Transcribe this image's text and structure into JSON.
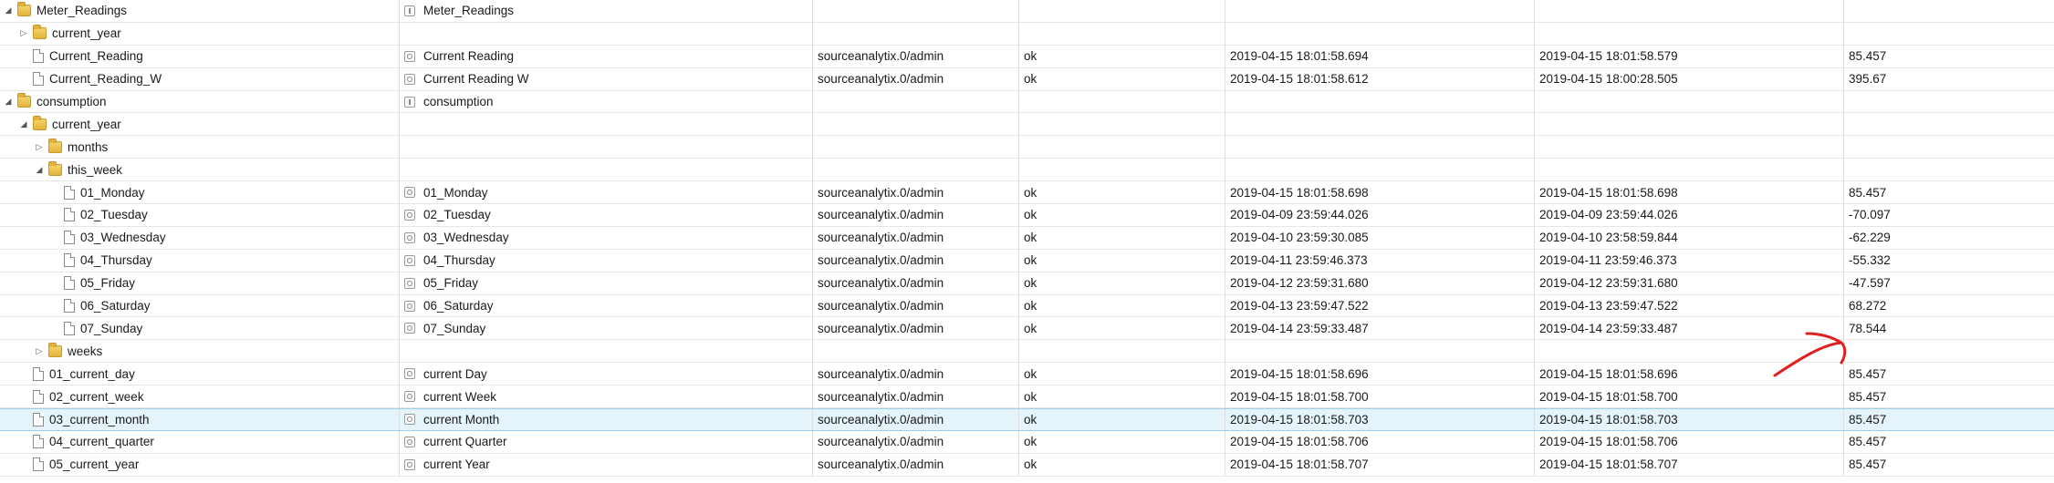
{
  "colors": {
    "annotation": "#e02020",
    "selection": "#e5f3fb",
    "folder": "#e2b33c"
  },
  "rows": [
    {
      "depth": 0,
      "expand": "expanded",
      "icon": "folder-icon",
      "id": "Meter_Readings",
      "name_icon": "channel-icon",
      "name": "Meter_Readings",
      "from": "",
      "ack": "",
      "ts": "",
      "lc": "",
      "value": ""
    },
    {
      "depth": 1,
      "expand": "collapsed",
      "icon": "folder-icon",
      "id": "current_year",
      "name_icon": "",
      "name": "",
      "from": "",
      "ack": "",
      "ts": "",
      "lc": "",
      "value": ""
    },
    {
      "depth": 1,
      "expand": "none",
      "icon": "file-icon",
      "id": "Current_Reading",
      "name_icon": "state-icon",
      "name": "Current Reading",
      "from": "sourceanalytix.0/admin",
      "ack": "ok",
      "ts": "2019-04-15 18:01:58.694",
      "lc": "2019-04-15 18:01:58.579",
      "value": "85.457"
    },
    {
      "depth": 1,
      "expand": "none",
      "icon": "file-icon",
      "id": "Current_Reading_W",
      "name_icon": "state-icon",
      "name": "Current Reading W",
      "from": "sourceanalytix.0/admin",
      "ack": "ok",
      "ts": "2019-04-15 18:01:58.612",
      "lc": "2019-04-15 18:00:28.505",
      "value": "395.67"
    },
    {
      "depth": 0,
      "expand": "expanded",
      "icon": "folder-icon",
      "id": "consumption",
      "name_icon": "channel-icon",
      "name": "consumption",
      "from": "",
      "ack": "",
      "ts": "",
      "lc": "",
      "value": ""
    },
    {
      "depth": 1,
      "expand": "expanded",
      "icon": "folder-icon",
      "id": "current_year",
      "name_icon": "",
      "name": "",
      "from": "",
      "ack": "",
      "ts": "",
      "lc": "",
      "value": ""
    },
    {
      "depth": 2,
      "expand": "collapsed",
      "icon": "folder-icon",
      "id": "months",
      "name_icon": "",
      "name": "",
      "from": "",
      "ack": "",
      "ts": "",
      "lc": "",
      "value": ""
    },
    {
      "depth": 2,
      "expand": "expanded",
      "icon": "folder-icon",
      "id": "this_week",
      "name_icon": "",
      "name": "",
      "from": "",
      "ack": "",
      "ts": "",
      "lc": "",
      "value": ""
    },
    {
      "depth": 3,
      "expand": "none",
      "icon": "file-icon",
      "id": "01_Monday",
      "name_icon": "state-icon",
      "name": "01_Monday",
      "from": "sourceanalytix.0/admin",
      "ack": "ok",
      "ts": "2019-04-15 18:01:58.698",
      "lc": "2019-04-15 18:01:58.698",
      "value": "85.457"
    },
    {
      "depth": 3,
      "expand": "none",
      "icon": "file-icon",
      "id": "02_Tuesday",
      "name_icon": "state-icon",
      "name": "02_Tuesday",
      "from": "sourceanalytix.0/admin",
      "ack": "ok",
      "ts": "2019-04-09 23:59:44.026",
      "lc": "2019-04-09 23:59:44.026",
      "value": "-70.097"
    },
    {
      "depth": 3,
      "expand": "none",
      "icon": "file-icon",
      "id": "03_Wednesday",
      "name_icon": "state-icon",
      "name": "03_Wednesday",
      "from": "sourceanalytix.0/admin",
      "ack": "ok",
      "ts": "2019-04-10 23:59:30.085",
      "lc": "2019-04-10 23:58:59.844",
      "value": "-62.229"
    },
    {
      "depth": 3,
      "expand": "none",
      "icon": "file-icon",
      "id": "04_Thursday",
      "name_icon": "state-icon",
      "name": "04_Thursday",
      "from": "sourceanalytix.0/admin",
      "ack": "ok",
      "ts": "2019-04-11 23:59:46.373",
      "lc": "2019-04-11 23:59:46.373",
      "value": "-55.332"
    },
    {
      "depth": 3,
      "expand": "none",
      "icon": "file-icon",
      "id": "05_Friday",
      "name_icon": "state-icon",
      "name": "05_Friday",
      "from": "sourceanalytix.0/admin",
      "ack": "ok",
      "ts": "2019-04-12 23:59:31.680",
      "lc": "2019-04-12 23:59:31.680",
      "value": "-47.597"
    },
    {
      "depth": 3,
      "expand": "none",
      "icon": "file-icon",
      "id": "06_Saturday",
      "name_icon": "state-icon",
      "name": "06_Saturday",
      "from": "sourceanalytix.0/admin",
      "ack": "ok",
      "ts": "2019-04-13 23:59:47.522",
      "lc": "2019-04-13 23:59:47.522",
      "value": "68.272"
    },
    {
      "depth": 3,
      "expand": "none",
      "icon": "file-icon",
      "id": "07_Sunday",
      "name_icon": "state-icon",
      "name": "07_Sunday",
      "from": "sourceanalytix.0/admin",
      "ack": "ok",
      "ts": "2019-04-14 23:59:33.487",
      "lc": "2019-04-14 23:59:33.487",
      "value": "78.544"
    },
    {
      "depth": 2,
      "expand": "collapsed",
      "icon": "folder-icon",
      "id": "weeks",
      "name_icon": "",
      "name": "",
      "from": "",
      "ack": "",
      "ts": "",
      "lc": "",
      "value": ""
    },
    {
      "depth": 1,
      "expand": "none",
      "icon": "file-icon",
      "id": "01_current_day",
      "name_icon": "state-icon",
      "name": "current Day",
      "from": "sourceanalytix.0/admin",
      "ack": "ok",
      "ts": "2019-04-15 18:01:58.696",
      "lc": "2019-04-15 18:01:58.696",
      "value": "85.457"
    },
    {
      "depth": 1,
      "expand": "none",
      "icon": "file-icon",
      "id": "02_current_week",
      "name_icon": "state-icon",
      "name": "current Week",
      "from": "sourceanalytix.0/admin",
      "ack": "ok",
      "ts": "2019-04-15 18:01:58.700",
      "lc": "2019-04-15 18:01:58.700",
      "value": "85.457"
    },
    {
      "depth": 1,
      "expand": "none",
      "icon": "file-icon",
      "id": "03_current_month",
      "name_icon": "state-icon",
      "name": "current Month",
      "from": "sourceanalytix.0/admin",
      "ack": "ok",
      "ts": "2019-04-15 18:01:58.703",
      "lc": "2019-04-15 18:01:58.703",
      "value": "85.457",
      "selected": true
    },
    {
      "depth": 1,
      "expand": "none",
      "icon": "file-icon",
      "id": "04_current_quarter",
      "name_icon": "state-icon",
      "name": "current Quarter",
      "from": "sourceanalytix.0/admin",
      "ack": "ok",
      "ts": "2019-04-15 18:01:58.706",
      "lc": "2019-04-15 18:01:58.706",
      "value": "85.457"
    },
    {
      "depth": 1,
      "expand": "none",
      "icon": "file-icon",
      "id": "05_current_year",
      "name_icon": "state-icon",
      "name": "current Year",
      "from": "sourceanalytix.0/admin",
      "ack": "ok",
      "ts": "2019-04-15 18:01:58.707",
      "lc": "2019-04-15 18:01:58.707",
      "value": "85.457"
    }
  ]
}
